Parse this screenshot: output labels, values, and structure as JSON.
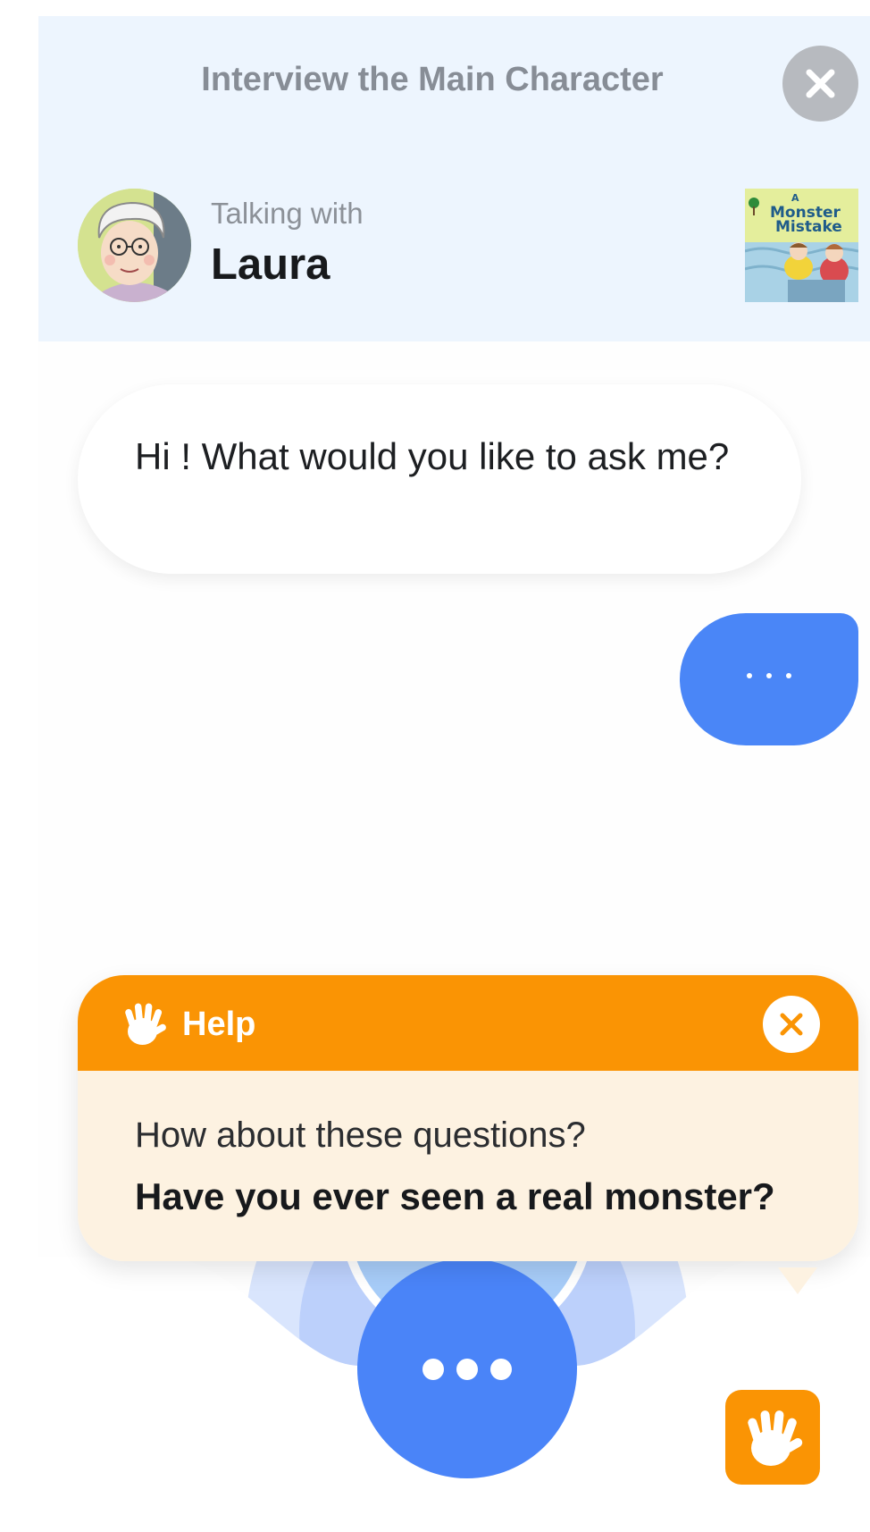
{
  "header": {
    "title": "Interview the Main Character",
    "talking_with_label": "Talking with",
    "character_name": "Laura",
    "book_cover_text": "A Monster Mistake"
  },
  "chat": {
    "messages": [
      {
        "from": "character",
        "text": "Hi ! What would you like to ask me?"
      },
      {
        "from": "user",
        "text": "..."
      }
    ]
  },
  "help": {
    "title": "Help",
    "prompt": "How about these questions?",
    "suggestion": "Have you ever seen a real monster?"
  },
  "colors": {
    "accent_blue": "#4a86f7",
    "help_orange": "#fa9404",
    "header_bg": "#edf5fe",
    "help_body_bg": "#fdf2e1"
  },
  "icons": {
    "close": "close-icon",
    "hand": "hand-wave-icon"
  }
}
